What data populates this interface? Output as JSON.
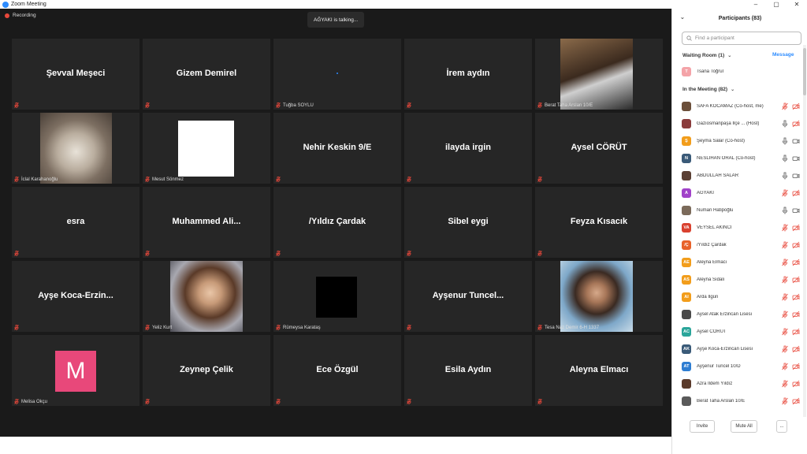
{
  "window": {
    "title": "Zoom Meeting",
    "controls": [
      "–",
      "▢",
      "✕"
    ]
  },
  "meeting": {
    "recording_label": "Recording",
    "talking_indicator": "AĞYAKI is talking...",
    "tiles": [
      {
        "name": "Şevval Meşeci",
        "label": ""
      },
      {
        "name": "Gizem Demirel",
        "label": ""
      },
      {
        "name": "",
        "label": "Tuğba SOYLU"
      },
      {
        "name": "İrem aydın",
        "label": ""
      },
      {
        "name": "",
        "label": "Berat Taha Arslan 10/E"
      },
      {
        "name": "",
        "label": "İclal Karahanoğlu"
      },
      {
        "name": "",
        "label": "Mesut Sönmez"
      },
      {
        "name": "Nehir Keskin 9/E",
        "label": ""
      },
      {
        "name": "ilayda irgin",
        "label": ""
      },
      {
        "name": "Aysel CÖRÜT",
        "label": ""
      },
      {
        "name": "esra",
        "label": ""
      },
      {
        "name": "Muhammed  Ali...",
        "label": ""
      },
      {
        "name": "/Yıldız Çardak",
        "label": ""
      },
      {
        "name": "Sibel eygi",
        "label": ""
      },
      {
        "name": "Feyza Kısacık",
        "label": ""
      },
      {
        "name": "Ayşe  Koca-Erzin...",
        "label": ""
      },
      {
        "name": "",
        "label": "Yeliz Kurt"
      },
      {
        "name": "",
        "label": "Rümeysa Karataş"
      },
      {
        "name": "Ayşenur  Tuncel...",
        "label": ""
      },
      {
        "name": "",
        "label": "Tesa Naz Demir 6-H 1337"
      },
      {
        "name": "",
        "label": "Melisa Okçu",
        "avatar_letter": "M"
      },
      {
        "name": "Zeynep Çelik",
        "label": ""
      },
      {
        "name": "Ece Özgül",
        "label": ""
      },
      {
        "name": "Esila Aydın",
        "label": ""
      },
      {
        "name": "Aleyna Elmacı",
        "label": ""
      }
    ]
  },
  "participants": {
    "title": "Participants (83)",
    "search_placeholder": "Find a participant",
    "waiting_room_label": "Waiting Room (1)",
    "message_label": "Message",
    "waiting": [
      {
        "name": "Tsana Toğrul",
        "initials": "T",
        "color": "#f4a3a8"
      }
    ],
    "in_meeting_label": "In the Meeting (82)",
    "list": [
      {
        "name": "SAFA KOCAMAZ (Co-host, me)",
        "initials": "",
        "color": "#6b4f3a"
      },
      {
        "name": "Gazıosmanpaşa İlçe ... (Host)",
        "initials": "",
        "color": "#8a3b3b"
      },
      {
        "name": "Şeyma Salar (Co-host)",
        "initials": "Ş",
        "color": "#f29d1b"
      },
      {
        "name": "NESLİHAN ORAL (Co-host)",
        "initials": "N",
        "color": "#3a5a78"
      },
      {
        "name": "ABDULLAH SALAR",
        "initials": "",
        "color": "#5b4034"
      },
      {
        "name": "AĞYAKI",
        "initials": "A",
        "color": "#a142c9"
      },
      {
        "name": "Numan Hatipoğlu",
        "initials": "",
        "color": "#7b6a5a"
      },
      {
        "name": "VEYSEL AKINCI",
        "initials": "VA",
        "color": "#d9412f"
      },
      {
        "name": "/Yıldız Çardak",
        "initials": "/Ç",
        "color": "#e8622a"
      },
      {
        "name": "Aleyna Elmacı",
        "initials": "AE",
        "color": "#f29d1b"
      },
      {
        "name": "Aleyna Sıdalı",
        "initials": "AS",
        "color": "#f29d1b"
      },
      {
        "name": "Arda İlgün",
        "initials": "AI",
        "color": "#f29d1b"
      },
      {
        "name": "Aysel Atak Erzincan Lisesi",
        "initials": "",
        "color": "#4a4a4a"
      },
      {
        "name": "Aysel CÖRÜT",
        "initials": "AC",
        "color": "#2aa59a"
      },
      {
        "name": "Ayşe Koca-Erzincan Lisesi",
        "initials": "AK",
        "color": "#3a5a78"
      },
      {
        "name": "Ayşenur Tuncel 10/D",
        "initials": "AT",
        "color": "#2d7dd2"
      },
      {
        "name": "Azra İldem Yıldız",
        "initials": "",
        "color": "#5a3a2a"
      },
      {
        "name": "Berat Taha Arslan 10/E",
        "initials": "",
        "color": "#5a5a5a"
      }
    ],
    "invite_label": "Invite",
    "mute_all_label": "Mute All",
    "more_label": "..."
  }
}
